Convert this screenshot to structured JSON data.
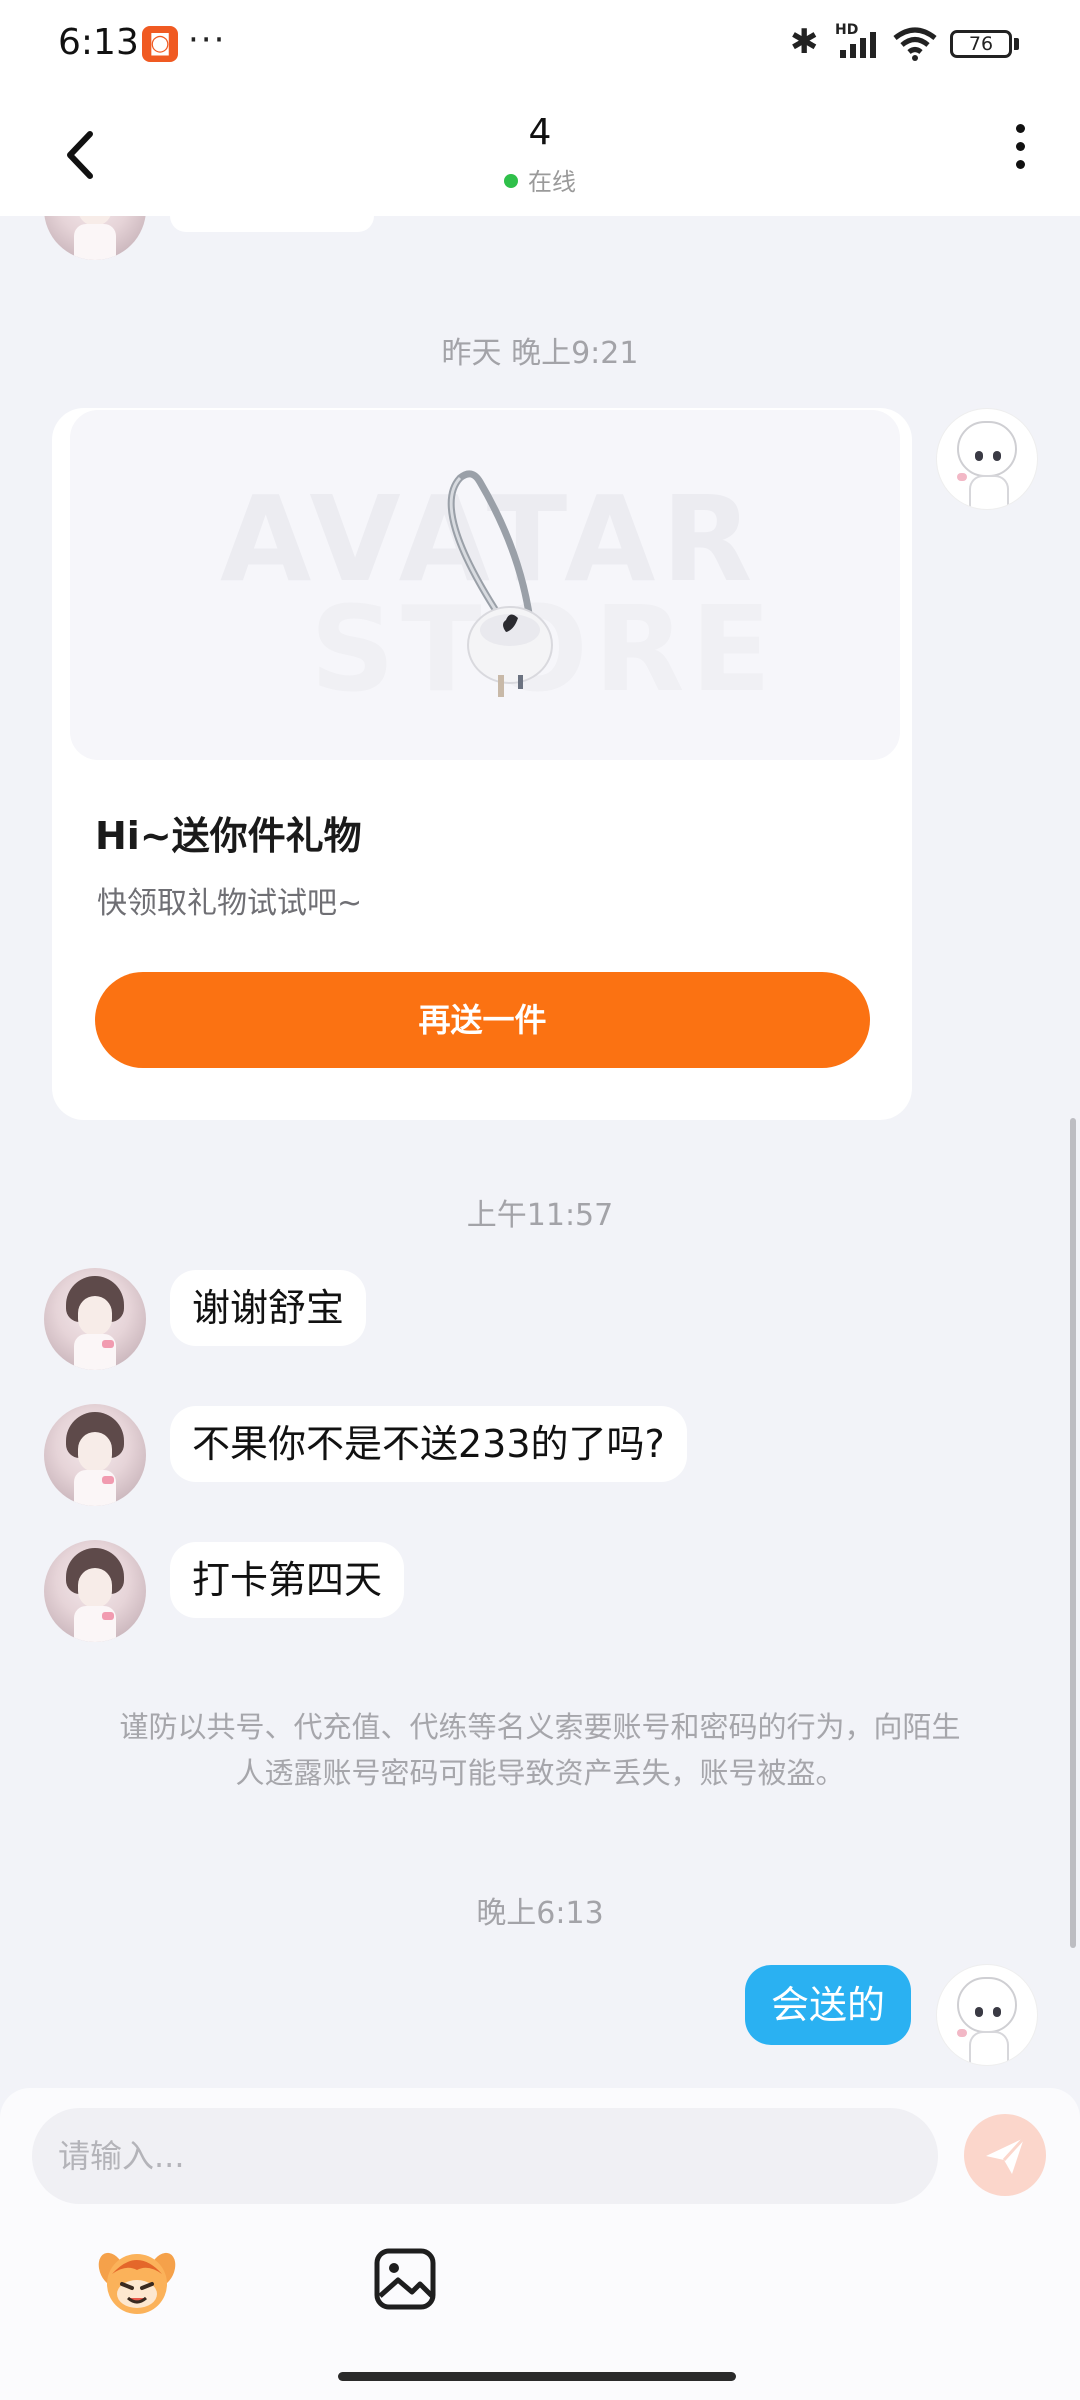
{
  "status_bar": {
    "time": "6:13",
    "more": "···",
    "bluetooth_icon": "bluetooth-icon",
    "hd_label": "HD",
    "battery": "76"
  },
  "header": {
    "title": "4",
    "status": "在线",
    "back_icon": "back-arrow-icon",
    "menu_icon": "more-vertical-icon"
  },
  "messages": {
    "ts1": "昨天 晚上9:21",
    "gift_card": {
      "watermark_line1": "AVATAR",
      "watermark_line2": "STORE",
      "title": "Hi~送你件礼物",
      "subtitle": "快领取礼物试试吧~",
      "button": "再送一件"
    },
    "ts2": "上午11:57",
    "incoming": [
      "谢谢舒宝",
      "不果你不是不送233的了吗?",
      "打卡第四天"
    ],
    "notice_line1": "谨防以共号、代充值、代练等名义索要账号和密码的行为，向陌生",
    "notice_line2": "人透露账号密码可能导致资产丢失，账号被盗。",
    "ts3": "晚上6:13",
    "outgoing": "会送的"
  },
  "composer": {
    "placeholder": "请输入...",
    "send_icon": "send-icon",
    "emoji_icon": "emoji-icon",
    "image_icon": "image-icon"
  },
  "colors": {
    "accent_orange": "#fb7212",
    "bubble_out": "#2ab1f2",
    "online_green": "#2fc04a",
    "background": "#f2f3f8"
  }
}
